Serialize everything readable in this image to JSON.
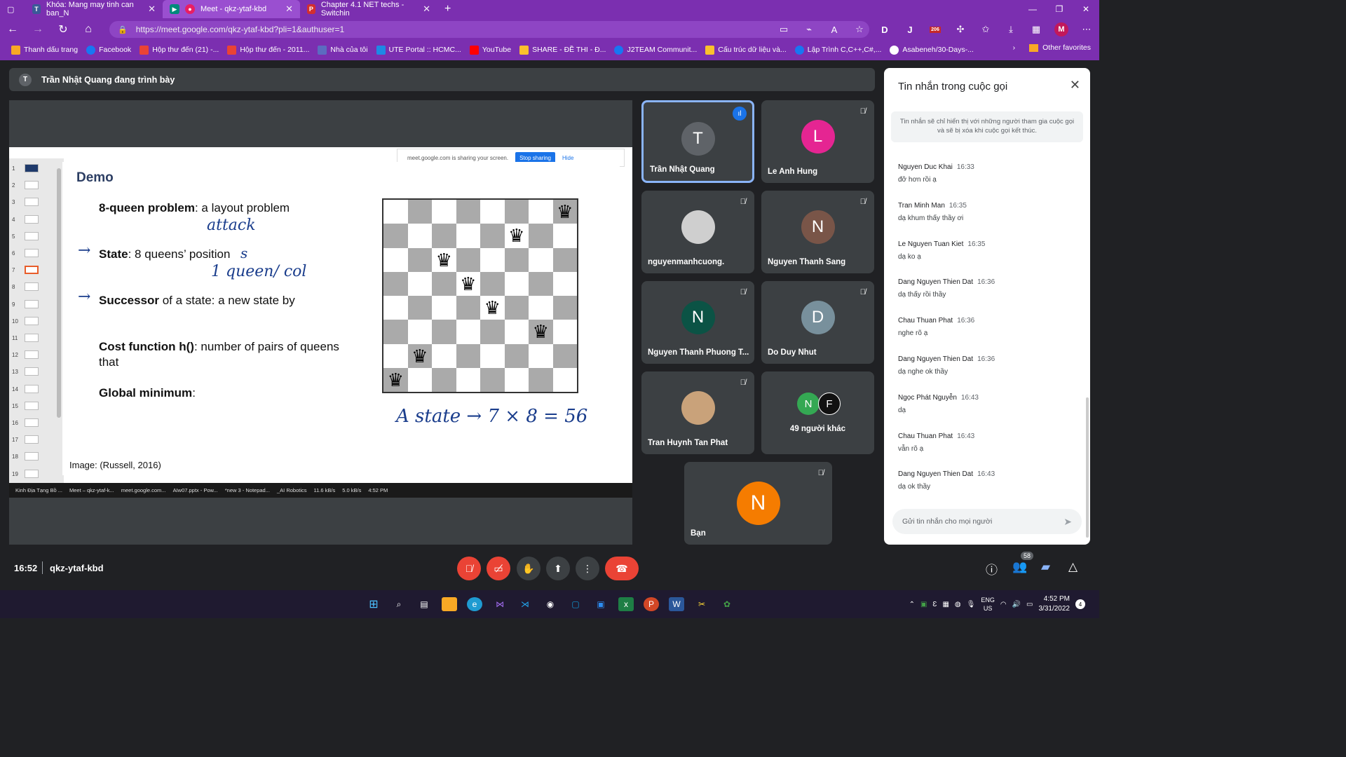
{
  "browser": {
    "tabs": [
      {
        "label": "Khóa: Mang may tinh can ban_N",
        "active": false
      },
      {
        "label": "Meet - qkz-ytaf-kbd",
        "active": true
      },
      {
        "label": "Chapter 4.1 NET techs - Switchin",
        "active": false
      }
    ],
    "new_tab": "+",
    "url": "https://meet.google.com/qkz-ytaf-kbd?pli=1&authuser=1",
    "profile_initial": "M",
    "ext_d": "D",
    "ext_badge": "206",
    "bookmarks": [
      "Thanh dấu trang",
      "Facebook",
      "Hộp thư đến (21) -...",
      "Hộp thư đến - 2011...",
      "Nhà của tôi",
      "UTE Portal :: HCMC...",
      "YouTube",
      "SHARE - ĐỀ THI - Đ...",
      "J2TEAM Communit...",
      "Cấu trúc dữ liệu và...",
      "Lập Trình C,C++,C#,...",
      "Asabeneh/30-Days-..."
    ],
    "other_favorites": "Other favorites"
  },
  "meet": {
    "presenter_initial": "T",
    "presenter_text": "Trần Nhật Quang đang trình bày",
    "meeting_time": "16:52",
    "meeting_code": "qkz-ytaf-kbd",
    "participants_badge": "58"
  },
  "slide": {
    "title": "Demo",
    "lines": [
      {
        "bold": "8-queen problem",
        "rest": ": a layout problem"
      },
      {
        "bold": "State",
        "rest": ": 8 queens’ position"
      },
      {
        "bold": "Successor",
        "rest": " of a state: a new state by"
      },
      {
        "bold": "Cost function h()",
        "rest": ": number of pairs of queens"
      },
      {
        "bold": "",
        "rest": "that"
      },
      {
        "bold": "Global minimum",
        "rest": ":"
      }
    ],
    "handwriting": {
      "attack": "attack",
      "s": "s",
      "one_queen_col": "1 queen/ col",
      "arrow": "→",
      "equation": "A state → 7 × 8 = 56"
    },
    "image_cite": "Image: (Russell, 2016)",
    "queen_glyph": "♛",
    "queens_by_col": [
      7,
      6,
      2,
      3,
      4,
      1,
      5,
      0
    ],
    "slide_numbers": [
      "1",
      "2",
      "3",
      "4",
      "5",
      "6",
      "7",
      "8",
      "9",
      "10",
      "11",
      "12",
      "13",
      "14",
      "15",
      "16",
      "17",
      "18",
      "19"
    ],
    "selected_slide": "7",
    "share_banner": {
      "text": "meet.google.com is sharing your screen.",
      "stop": "Stop sharing",
      "hide": "Hide"
    },
    "mini_taskbar": [
      "Kinh Địa Tạng Bồ ...",
      "Meet – qkz-ytaf-k...",
      "meet.google.com...",
      "AIw07.pptx - Pow...",
      "*new 3 - Notepad...",
      "_AI Robotics",
      "11.6 kB/s",
      "5.0 kB/s",
      "4:52 PM"
    ]
  },
  "tiles": [
    {
      "name": "Trần Nhật Quang",
      "initial": "T",
      "color": "#5f6368",
      "speaking": true
    },
    {
      "name": "Le Anh Hung",
      "initial": "L",
      "color": "#e52592"
    },
    {
      "name": "nguyenmanhcuong.",
      "initial": "",
      "color": "#cfcfcf"
    },
    {
      "name": "Nguyen Thanh Sang",
      "initial": "N",
      "color": "#795548"
    },
    {
      "name": "Nguyen Thanh Phuong T...",
      "initial": "N",
      "color": "#0b5345"
    },
    {
      "name": "Do Duy Nhut",
      "initial": "D",
      "color": "#78909c"
    },
    {
      "name": "Tran Huynh Tan Phat",
      "initial": "",
      "color": "#c9a27a"
    },
    {
      "name": "49 người khác",
      "initial": "N",
      "color": "#34a853",
      "extra_initial": "F"
    },
    {
      "name": "Bạn",
      "initial": "N",
      "color": "#f57c00"
    }
  ],
  "chat": {
    "title": "Tin nhắn trong cuộc gọi",
    "note": "Tin nhắn sẽ chỉ hiển thị với những người tham gia cuộc gọi và sẽ bị xóa khi cuộc gọi kết thúc.",
    "messages": [
      {
        "who": "Nguyen Duc Khai",
        "time": "16:33",
        "text": "đỡ hơn rồi ạ"
      },
      {
        "who": "Tran Minh Man",
        "time": "16:35",
        "text": "dạ khum thấy thầy ơi"
      },
      {
        "who": "Le Nguyen Tuan Kiet",
        "time": "16:35",
        "text": "dạ ko ạ"
      },
      {
        "who": "Dang Nguyen Thien Dat",
        "time": "16:36",
        "text": "dạ thấy rồi thầy"
      },
      {
        "who": "Chau Thuan Phat",
        "time": "16:36",
        "text": "nghe rõ ạ"
      },
      {
        "who": "Dang Nguyen Thien Dat",
        "time": "16:36",
        "text": "dạ nghe ok thầy"
      },
      {
        "who": "Ngọc Phát Nguyễn",
        "time": "16:43",
        "text": "dạ"
      },
      {
        "who": "Chau Thuan Phat",
        "time": "16:43",
        "text": "vẫn rõ ạ"
      },
      {
        "who": "Dang Nguyen Thien Dat",
        "time": "16:43",
        "text": "dạ ok thầy"
      }
    ],
    "placeholder": "Gửi tin nhắn cho mọi người"
  },
  "taskbar": {
    "lang1": "ENG",
    "lang2": "US",
    "time": "4:52 PM",
    "date": "3/31/2022",
    "notif": "4"
  }
}
